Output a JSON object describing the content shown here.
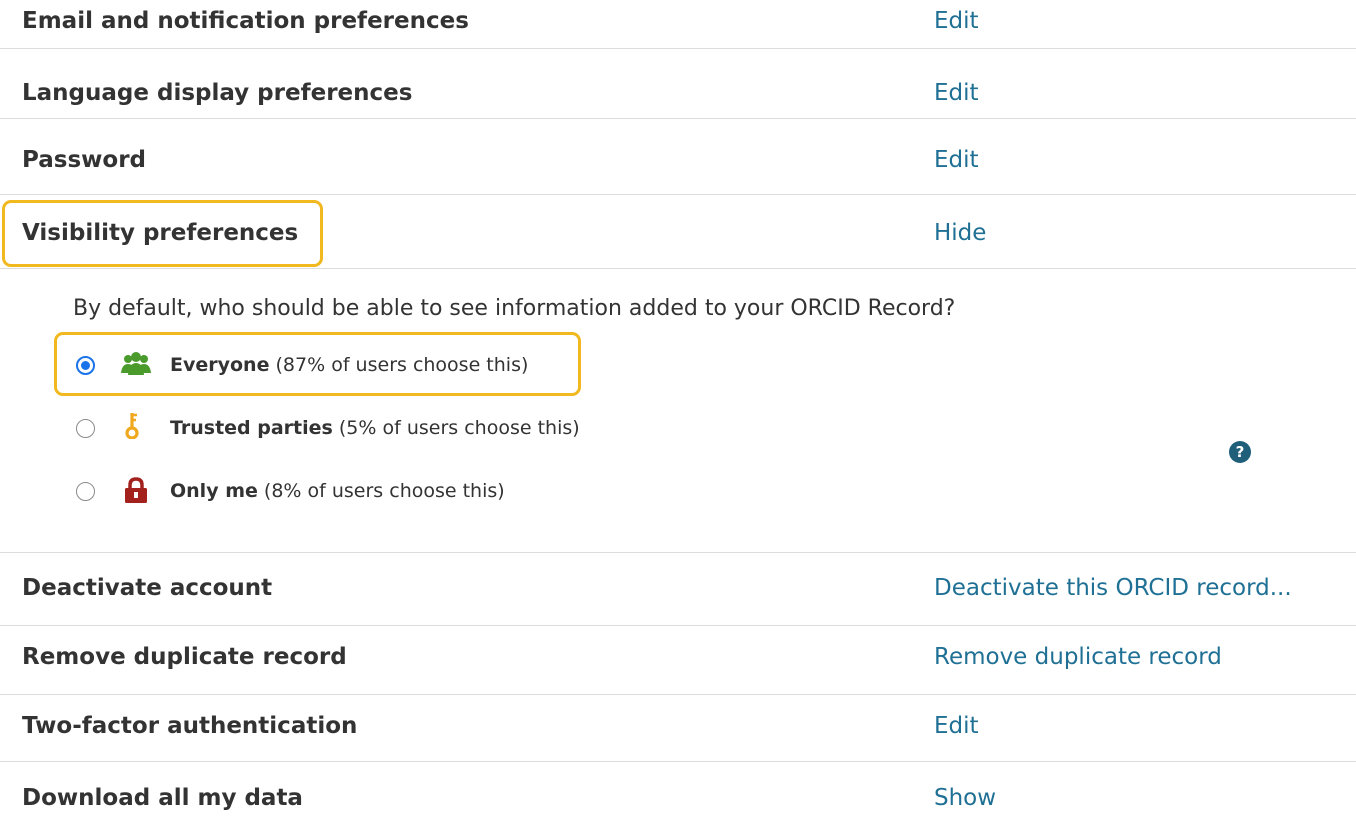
{
  "rows_top": [
    {
      "label": "Email and notification preferences",
      "action": "Edit"
    },
    {
      "label": "Language display preferences",
      "action": "Edit"
    },
    {
      "label": "Password",
      "action": "Edit"
    },
    {
      "label": "Visibility preferences",
      "action": "Hide"
    }
  ],
  "visibility": {
    "question": "By default, who should be able to see information added to your ORCID Record?",
    "options": [
      {
        "name": "Everyone",
        "detail": " (87% of users choose this)",
        "selected": true,
        "icon": "group-icon",
        "color": "#4a9a2c"
      },
      {
        "name": "Trusted parties",
        "detail": " (5% of users choose this)",
        "selected": false,
        "icon": "key-icon",
        "color": "#f0a81e"
      },
      {
        "name": "Only me",
        "detail": " (8% of users choose this)",
        "selected": false,
        "icon": "lock-icon",
        "color": "#a3221e"
      }
    ],
    "help_icon": "?"
  },
  "rows_bottom": [
    {
      "label": "Deactivate account",
      "action": "Deactivate this ORCID record..."
    },
    {
      "label": "Remove duplicate record",
      "action": "Remove duplicate record"
    },
    {
      "label": "Two-factor authentication",
      "action": "Edit"
    },
    {
      "label": "Download all my data",
      "action": "Show"
    }
  ],
  "colors": {
    "link": "#1f7094",
    "highlight": "#f2b81f",
    "radio_selected": "#1a73e8"
  }
}
